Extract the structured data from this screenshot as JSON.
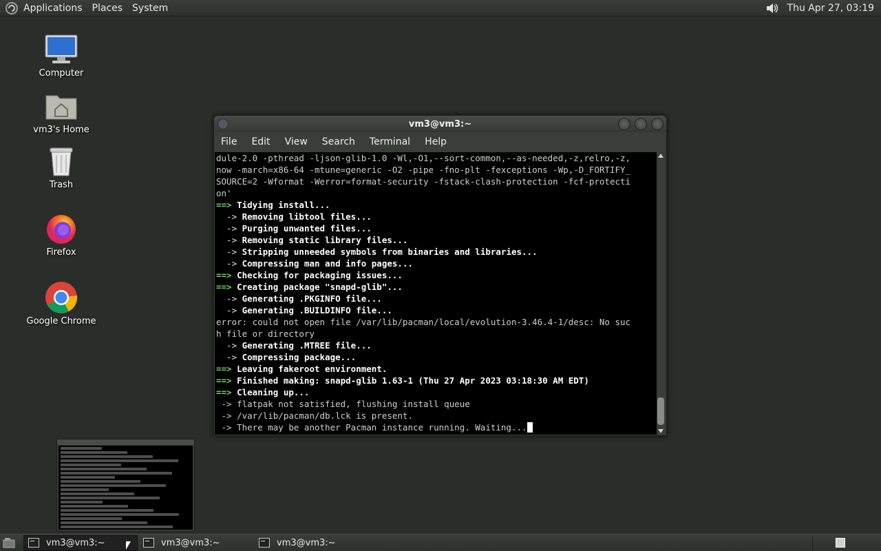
{
  "top_panel": {
    "menus": [
      "Applications",
      "Places",
      "System"
    ],
    "clock": "Thu Apr 27, 03:19"
  },
  "desktop_icons": [
    {
      "label": "Computer",
      "icon": "computer-icon"
    },
    {
      "label": "vm3's Home",
      "icon": "home-folder-icon"
    },
    {
      "label": "Trash",
      "icon": "trash-icon"
    },
    {
      "label": "Firefox",
      "icon": "firefox-icon"
    },
    {
      "label": "Google Chrome",
      "icon": "chrome-icon"
    }
  ],
  "terminal": {
    "title": "vm3@vm3:~",
    "menu": [
      "File",
      "Edit",
      "View",
      "Search",
      "Terminal",
      "Help"
    ],
    "lines": [
      {
        "prefix": "",
        "text": "dule-2.0 -pthread -ljson-glib-1.0 -Wl,-O1,--sort-common,--as-needed,-z,relro,-z,",
        "style": "plain"
      },
      {
        "prefix": "",
        "text": "now -march=x86-64 -mtune=generic -O2 -pipe -fno-plt -fexceptions -Wp,-D_FORTIFY_",
        "style": "plain"
      },
      {
        "prefix": "",
        "text": "SOURCE=2 -Wformat -Werror=format-security -fstack-clash-protection -fcf-protecti",
        "style": "plain"
      },
      {
        "prefix": "",
        "text": "on'",
        "style": "plain"
      },
      {
        "prefix": "==>",
        "text": " Tidying install...",
        "style": "green"
      },
      {
        "prefix": "  ->",
        "text": " Removing libtool files...",
        "style": "arrow"
      },
      {
        "prefix": "  ->",
        "text": " Purging unwanted files...",
        "style": "arrow"
      },
      {
        "prefix": "  ->",
        "text": " Removing static library files...",
        "style": "arrow"
      },
      {
        "prefix": "  ->",
        "text": " Stripping unneeded symbols from binaries and libraries...",
        "style": "arrow"
      },
      {
        "prefix": "  ->",
        "text": " Compressing man and info pages...",
        "style": "arrow"
      },
      {
        "prefix": "==>",
        "text": " Checking for packaging issues...",
        "style": "green"
      },
      {
        "prefix": "==>",
        "text": " Creating package \"snapd-glib\"...",
        "style": "green"
      },
      {
        "prefix": "  ->",
        "text": " Generating .PKGINFO file...",
        "style": "arrow"
      },
      {
        "prefix": "  ->",
        "text": " Generating .BUILDINFO file...",
        "style": "arrow"
      },
      {
        "prefix": "",
        "text": "error: could not open file /var/lib/pacman/local/evolution-3.46.4-1/desc: No suc",
        "style": "plain"
      },
      {
        "prefix": "",
        "text": "h file or directory",
        "style": "plain"
      },
      {
        "prefix": "  ->",
        "text": " Generating .MTREE file...",
        "style": "arrow"
      },
      {
        "prefix": "  ->",
        "text": " Compressing package...",
        "style": "arrow"
      },
      {
        "prefix": "==>",
        "text": " Leaving fakeroot environment.",
        "style": "green"
      },
      {
        "prefix": "==>",
        "text": " Finished making: snapd-glib 1.63-1 (Thu 27 Apr 2023 03:18:30 AM EDT)",
        "style": "green"
      },
      {
        "prefix": "==>",
        "text": " Cleaning up...",
        "style": "green"
      },
      {
        "prefix": "",
        "text": " -> flatpak not satisfied, flushing install queue",
        "style": "plain"
      },
      {
        "prefix": "",
        "text": " -> /var/lib/pacman/db.lck is present.",
        "style": "plain"
      },
      {
        "prefix": "",
        "text": " -> There may be another Pacman instance running. Waiting...",
        "style": "plain"
      }
    ]
  },
  "taskbar": {
    "tasks": [
      {
        "label": "vm3@vm3:~",
        "active": true
      },
      {
        "label": "vm3@vm3:~",
        "active": false
      },
      {
        "label": "vm3@vm3:~",
        "active": false
      }
    ]
  }
}
